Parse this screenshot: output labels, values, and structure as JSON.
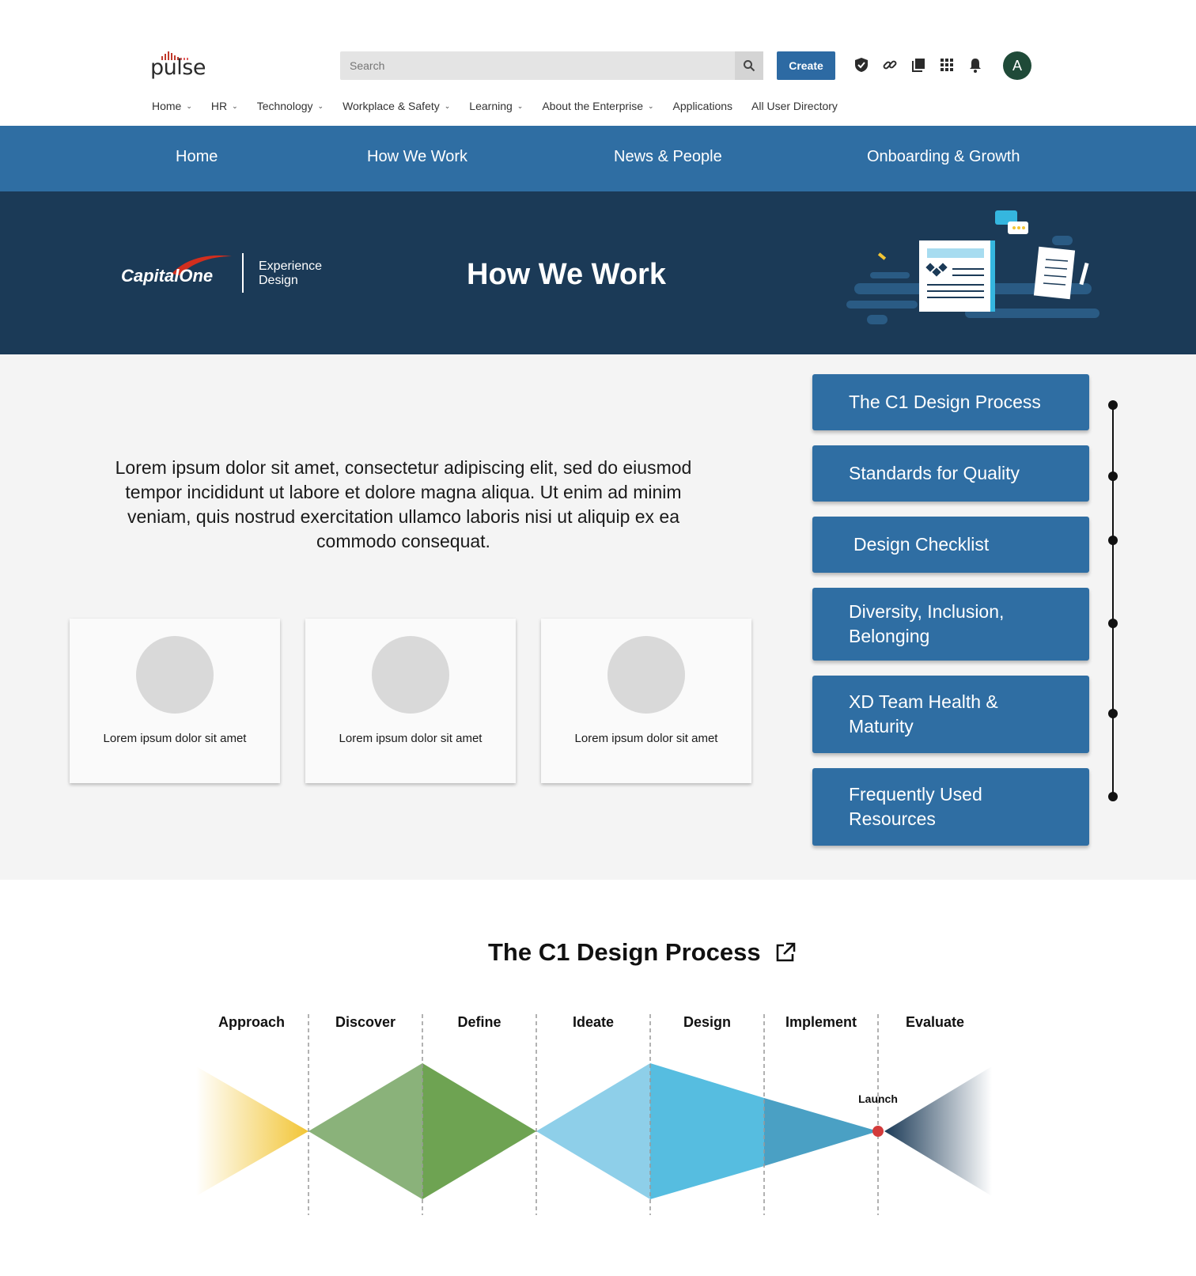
{
  "brand": {
    "logo_text": "pulse"
  },
  "search": {
    "placeholder": "Search"
  },
  "header": {
    "create_label": "Create",
    "avatar_initial": "A",
    "icons": [
      "shield-check-icon",
      "link-icon",
      "library-icon",
      "apps-grid-icon",
      "bell-icon"
    ]
  },
  "subnav": [
    {
      "label": "Home",
      "dropdown": true
    },
    {
      "label": "HR",
      "dropdown": true
    },
    {
      "label": "Technology",
      "dropdown": true
    },
    {
      "label": "Workplace & Safety",
      "dropdown": true
    },
    {
      "label": "Learning",
      "dropdown": true
    },
    {
      "label": "About the Enterprise",
      "dropdown": true
    },
    {
      "label": "Applications",
      "dropdown": false
    },
    {
      "label": "All User Directory",
      "dropdown": false
    }
  ],
  "site_nav": [
    "Home",
    "How We Work",
    "News & People",
    "Onboarding & Growth"
  ],
  "hero": {
    "org_name": "CapitalOne",
    "team_line1": "Experience",
    "team_line2": "Design",
    "title": "How We Work"
  },
  "intro": "Lorem ipsum dolor sit amet, consectetur adipiscing elit, sed do eiusmod tempor incididunt ut labore et dolore magna aliqua. Ut enim ad minim veniam, quis nostrud exercitation ullamco laboris nisi ut aliquip ex ea commodo consequat.",
  "cards": [
    {
      "caption": "Lorem ipsum dolor sit amet"
    },
    {
      "caption": "Lorem ipsum dolor sit amet"
    },
    {
      "caption": "Lorem ipsum dolor sit amet"
    }
  ],
  "side_links": [
    "The C1 Design Process",
    "Standards for Quality",
    "Design Checklist",
    "Diversity, Inclusion, Belonging",
    "XD Team Health & Maturity",
    "Frequently Used Resources"
  ],
  "process": {
    "title": "The C1 Design Process",
    "phases": [
      "Approach",
      "Discover",
      "Define",
      "Ideate",
      "Design",
      "Implement",
      "Evaluate"
    ],
    "milestone": "Launch",
    "colors": {
      "approach": "#f2c535",
      "discover": "#8ab27a",
      "define": "#6ea352",
      "ideate": "#8ecfe9",
      "design": "#56bde0",
      "implement": "#4aa0c4",
      "evaluate": "#1b3a57",
      "launch": "#d33b3b"
    }
  }
}
